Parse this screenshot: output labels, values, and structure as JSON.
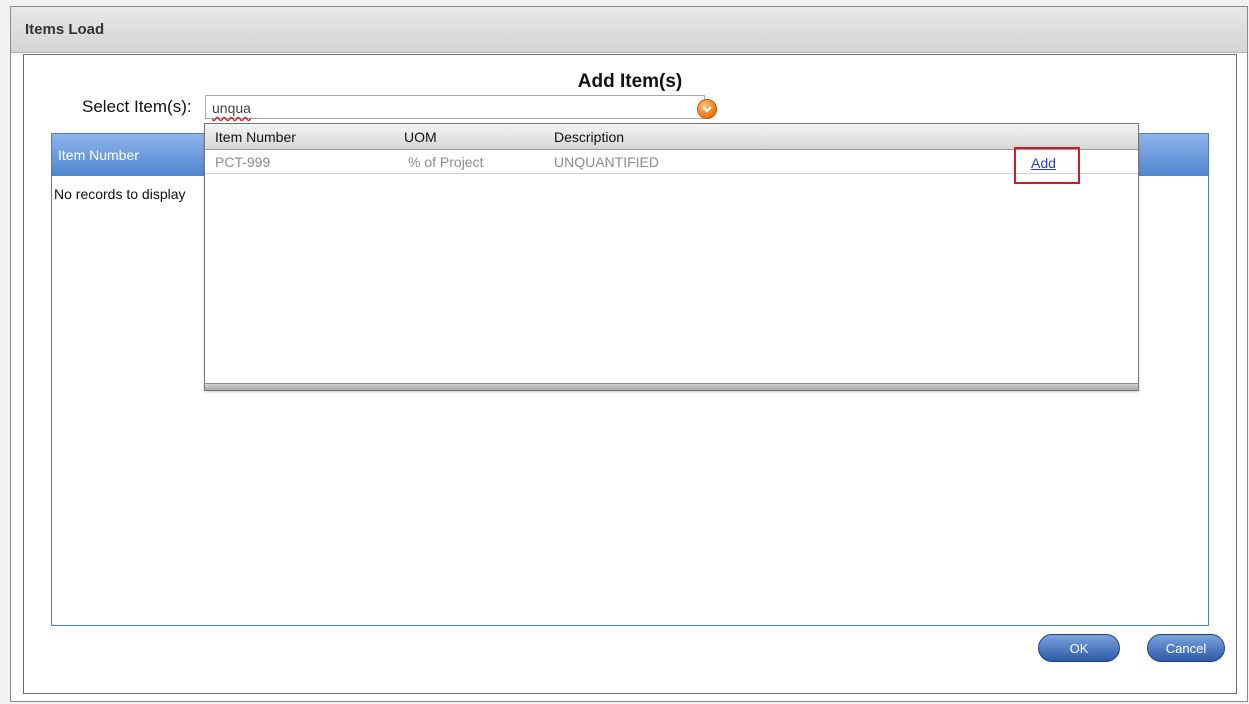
{
  "window": {
    "title": "Items Load"
  },
  "dialog": {
    "heading": "Add Item(s)",
    "select_label": "Select Item(s):",
    "select_value": "unqua"
  },
  "grid": {
    "column": "Item Number",
    "empty_text": "No records to display"
  },
  "popup": {
    "columns": [
      "Item Number",
      "UOM",
      "Description"
    ],
    "rows": [
      {
        "item_number": "PCT-999",
        "uom": "% of Project",
        "description": "UNQUANTIFIED",
        "action": "Add"
      }
    ]
  },
  "buttons": {
    "ok": "OK",
    "cancel": "Cancel"
  },
  "icons": {
    "dropdown": "chevron-down-icon"
  },
  "colors": {
    "accent": "#4f85cf",
    "dropdown": "#f07b17",
    "highlight": "#d3182a"
  }
}
